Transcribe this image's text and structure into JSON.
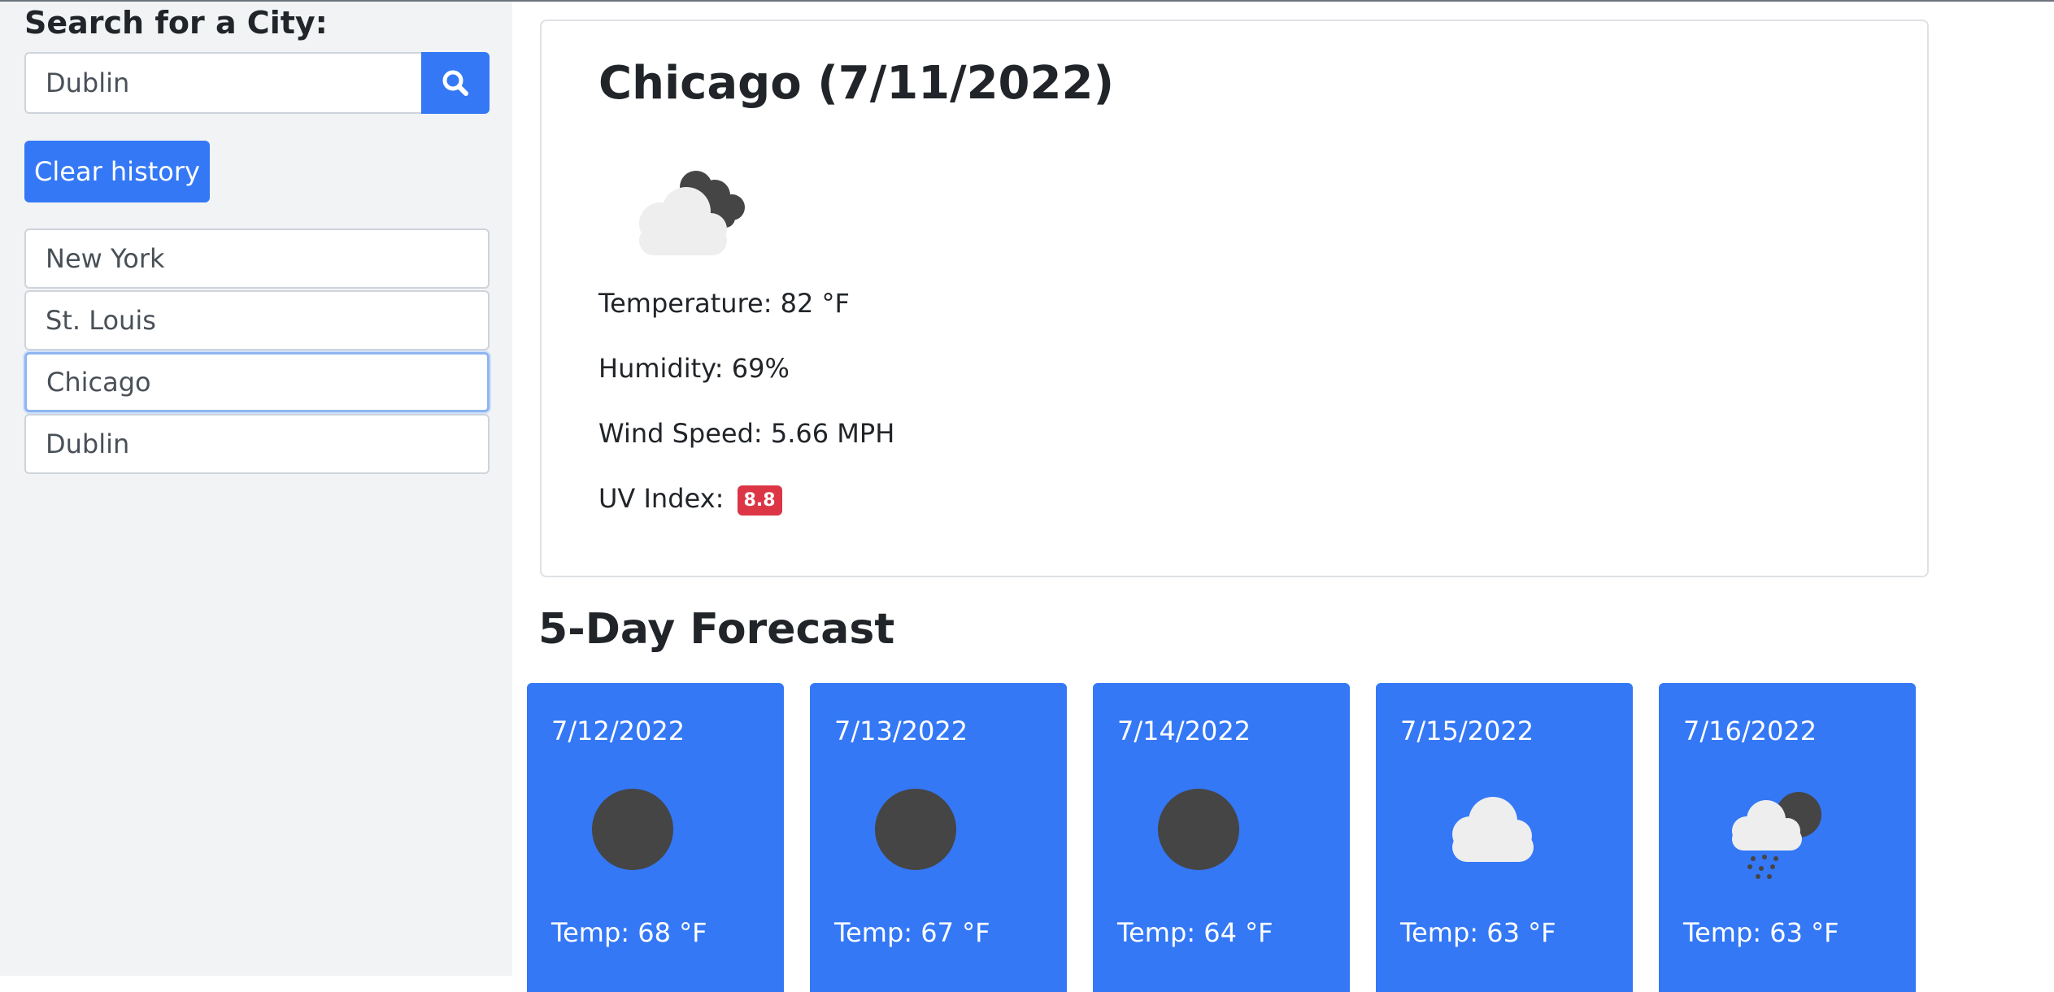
{
  "sidebar": {
    "heading": "Search for a City:",
    "search": {
      "value": "Dublin",
      "placeholder": ""
    },
    "search_icon": "search-icon",
    "clear_label": "Clear history",
    "history": [
      "New York",
      "St. Louis",
      "Chicago",
      "Dublin"
    ],
    "active_city": "Chicago"
  },
  "current": {
    "title": "Chicago (7/11/2022)",
    "icon": "partly-cloudy-night-icon",
    "temperature": "Temperature: 82 °F",
    "humidity": "Humidity: 69%",
    "wind": "Wind Speed: 5.66 MPH",
    "uv_label": "UV Index:",
    "uv_value": "8.8"
  },
  "forecast": {
    "heading": "5-Day Forecast",
    "days": [
      {
        "date": "7/12/2022",
        "icon": "clear-night-icon",
        "temp": "Temp: 68 °F"
      },
      {
        "date": "7/13/2022",
        "icon": "clear-night-icon",
        "temp": "Temp: 67 °F"
      },
      {
        "date": "7/14/2022",
        "icon": "clear-night-icon",
        "temp": "Temp: 64 °F"
      },
      {
        "date": "7/15/2022",
        "icon": "cloud-icon",
        "temp": "Temp: 63 °F"
      },
      {
        "date": "7/16/2022",
        "icon": "rain-night-icon",
        "temp": "Temp: 63 °F"
      }
    ]
  },
  "colors": {
    "accent": "#3478f6",
    "uv_badge": "#dc3545",
    "sidebar_bg": "#f1f3f5"
  }
}
